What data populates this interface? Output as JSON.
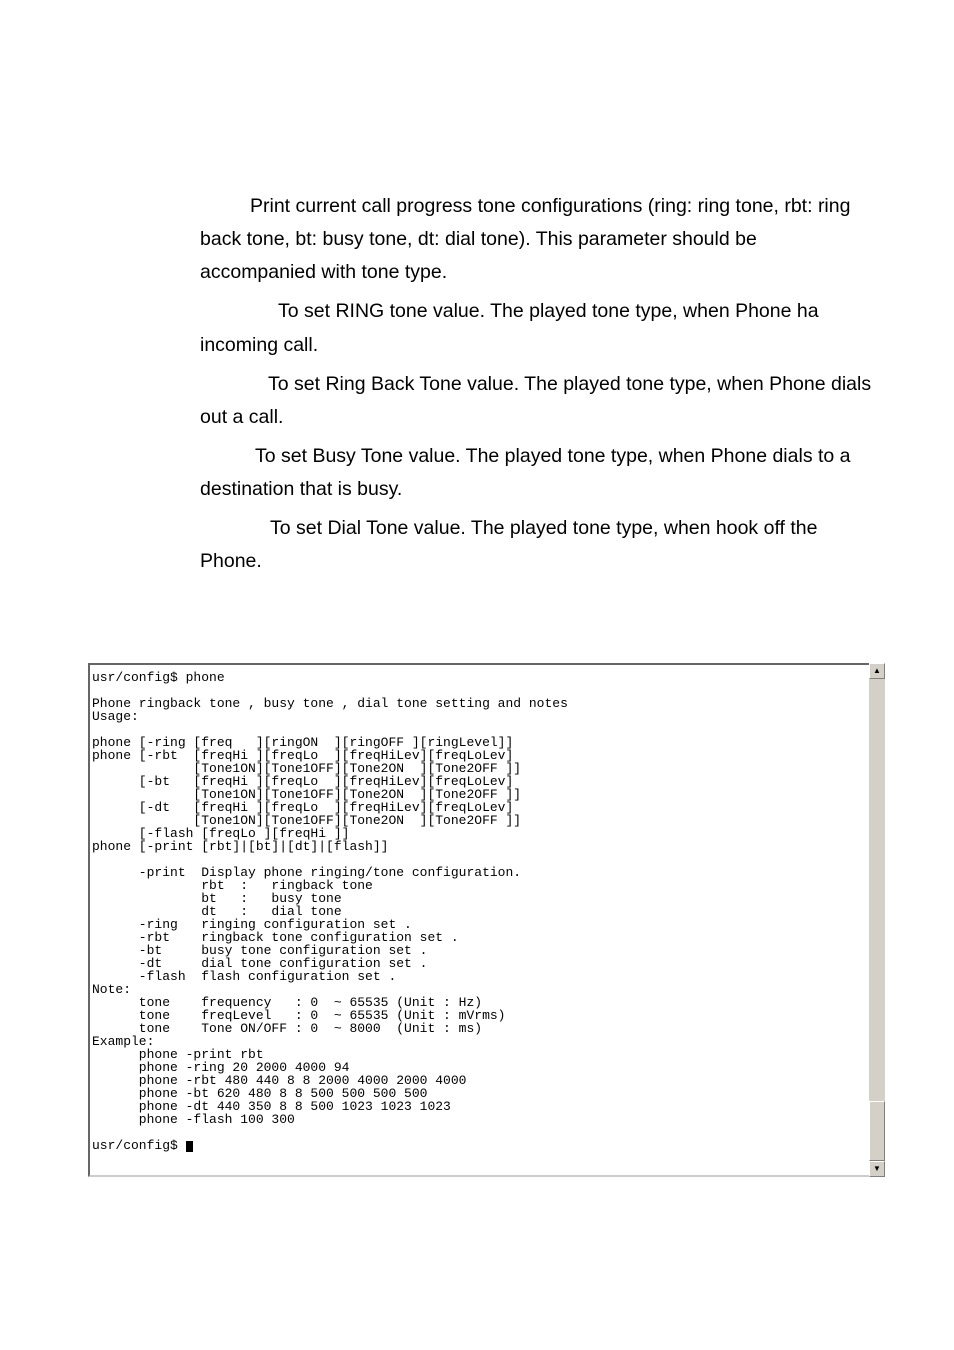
{
  "doc": {
    "p1": "Print current call progress tone configurations (ring: ring tone, rbt: ring back tone, bt: busy tone, dt: dial tone). This parameter should be accompanied with tone type.",
    "p2": "To set RING tone value. The played tone type, when Phone ha incoming call.",
    "p3": "To set Ring Back Tone value. The played tone type, when Phone dials out a call.",
    "p4": "To set Busy Tone value. The played tone type, when Phone dials to a destination that is busy.",
    "p5": "To set Dial Tone value. The played tone type, when hook off the Phone."
  },
  "terminal": {
    "content": "usr/config$ phone\n\nPhone ringback tone , busy tone , dial tone setting and notes\nUsage:\n\nphone [-ring [freq   ][ringON  ][ringOFF ][ringLevel]]\nphone [-rbt  [freqHi ][freqLo  ][freqHiLev][freqLoLev]\n             [Tone1ON][Tone1OFF][Tone2ON  ][Tone2OFF ]]\n      [-bt   [freqHi ][freqLo  ][freqHiLev][freqLoLev]\n             [Tone1ON][Tone1OFF][Tone2ON  ][Tone2OFF ]]\n      [-dt   [freqHi ][freqLo  ][freqHiLev][freqLoLev]\n             [Tone1ON][Tone1OFF][Tone2ON  ][Tone2OFF ]]\n      [-flash [freqLo ][freqHi ]]\nphone [-print [rbt]|[bt]|[dt]|[flash]]\n\n      -print  Display phone ringing/tone configuration.\n              rbt  :   ringback tone\n              bt   :   busy tone\n              dt   :   dial tone\n      -ring   ringing configuration set .\n      -rbt    ringback tone configuration set .\n      -bt     busy tone configuration set .\n      -dt     dial tone configuration set .\n      -flash  flash configuration set .\nNote:\n      tone    frequency   : 0  ~ 65535 (Unit : Hz)\n      tone    freqLevel   : 0  ~ 65535 (Unit : mVrms)\n      tone    Tone ON/OFF : 0  ~ 8000  (Unit : ms)\nExample:\n      phone -print rbt\n      phone -ring 20 2000 4000 94\n      phone -rbt 480 440 8 8 2000 4000 2000 4000\n      phone -bt 620 480 8 8 500 500 500 500\n      phone -dt 440 350 8 8 500 1023 1023 1023\n      phone -flash 100 300\n\nusr/config$ "
  },
  "scroll": {
    "up": "▲",
    "down": "▼"
  }
}
